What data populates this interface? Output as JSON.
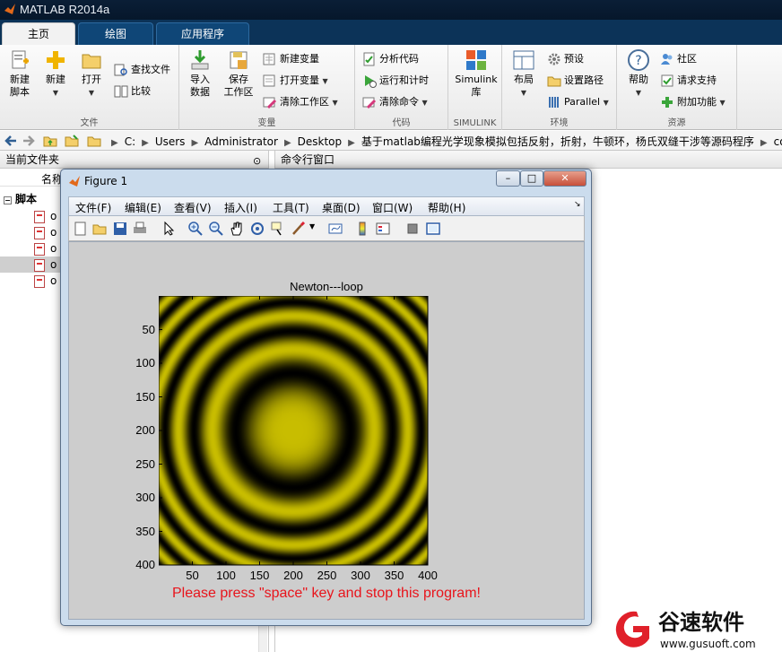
{
  "window": {
    "title": "MATLAB R2014a"
  },
  "tabs": [
    "主页",
    "绘图",
    "应用程序"
  ],
  "ribbon": {
    "file_group": {
      "label": "文件",
      "new_script": [
        "新建",
        "脚本"
      ],
      "new": "新建",
      "open": "打开",
      "find_files": "查找文件",
      "compare": "比较"
    },
    "variable_group": {
      "label": "变量",
      "import": [
        "导入",
        "数据"
      ],
      "save_ws": [
        "保存",
        "工作区"
      ],
      "new_var": "新建变量",
      "open_var": "打开变量",
      "clear_ws": "清除工作区"
    },
    "code_group": {
      "label": "代码",
      "analyze": "分析代码",
      "run_time": "运行和计时",
      "clear_cmd": "清除命令"
    },
    "simulink_group": {
      "label": "SIMULINK",
      "btn": [
        "Simulink",
        "库"
      ]
    },
    "env_group": {
      "label": "环境",
      "layout": "布局",
      "prefs": "预设",
      "set_path": "设置路径",
      "parallel": "Parallel"
    },
    "res_group": {
      "label": "资源",
      "help": "帮助",
      "community": "社区",
      "support": "请求支持",
      "addons": "附加功能"
    }
  },
  "address": {
    "parts": [
      "C:",
      "Users",
      "Administrator",
      "Desktop",
      "基于matlab编程光学现象模拟包括反射，折射，牛顿环，杨氏双缝干涉等源码程序",
      "coc"
    ]
  },
  "left_panel": {
    "title": "当前文件夹",
    "col_header": "名称",
    "group": "脚本",
    "files": [
      "o",
      "o",
      "o",
      "o",
      "o"
    ]
  },
  "right_panel": {
    "title": "命令行窗口"
  },
  "figure": {
    "title": "Figure 1",
    "menu": [
      "文件(F)",
      "编辑(E)",
      "查看(V)",
      "插入(I)",
      "工具(T)",
      "桌面(D)",
      "窗口(W)",
      "帮助(H)"
    ],
    "plot_title": "Newton---loop",
    "message": "Please press \"space\" key and stop this program!",
    "message_color": "#e8141b",
    "yticks": [
      50,
      100,
      150,
      200,
      250,
      300,
      350,
      400
    ],
    "xticks": [
      50,
      100,
      150,
      200,
      250,
      300,
      350,
      400
    ]
  },
  "watermark": {
    "brand": "谷速软件",
    "url": "www.gusuoft.com"
  },
  "colors": {
    "titlebar": "#07192e",
    "tabstrip": "#0c3358",
    "ring_yellow": "#c8bd00"
  }
}
